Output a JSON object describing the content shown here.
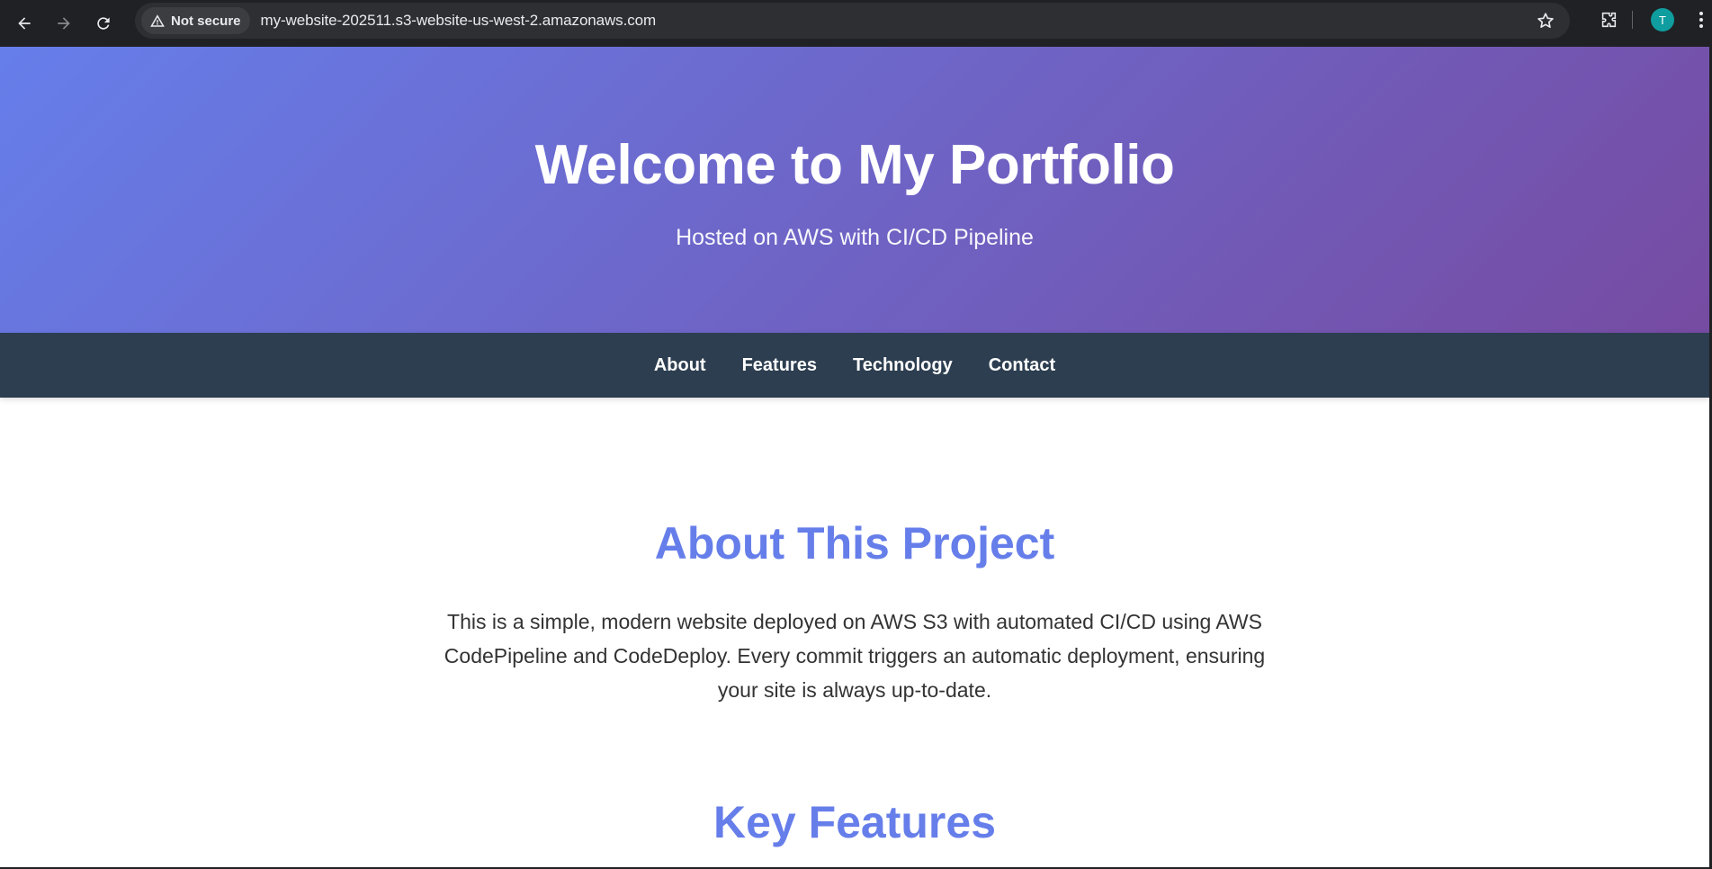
{
  "browser": {
    "security_label": "Not secure",
    "url": "my-website-202511.s3-website-us-west-2.amazonaws.com",
    "avatar_letter": "T",
    "icons": [
      "back-icon",
      "forward-icon",
      "reload-icon",
      "warning-icon",
      "star-icon",
      "extensions-icon",
      "menu-icon"
    ]
  },
  "hero": {
    "title": "Welcome to My Portfolio",
    "subtitle": "Hosted on AWS with CI/CD Pipeline"
  },
  "nav": {
    "items": [
      {
        "label": "About"
      },
      {
        "label": "Features"
      },
      {
        "label": "Technology"
      },
      {
        "label": "Contact"
      }
    ]
  },
  "about": {
    "heading": "About This Project",
    "body": "This is a simple, modern website deployed on AWS S3 with automated CI/CD using AWS CodePipeline and CodeDeploy. Every commit triggers an automatic deployment, ensuring your site is always up-to-date."
  },
  "features": {
    "heading": "Key Features"
  },
  "colors": {
    "gradient_start": "#667eea",
    "gradient_end": "#764ba2",
    "nav_bg": "#2c3e50",
    "heading": "#667eea",
    "body_text": "#333333"
  }
}
